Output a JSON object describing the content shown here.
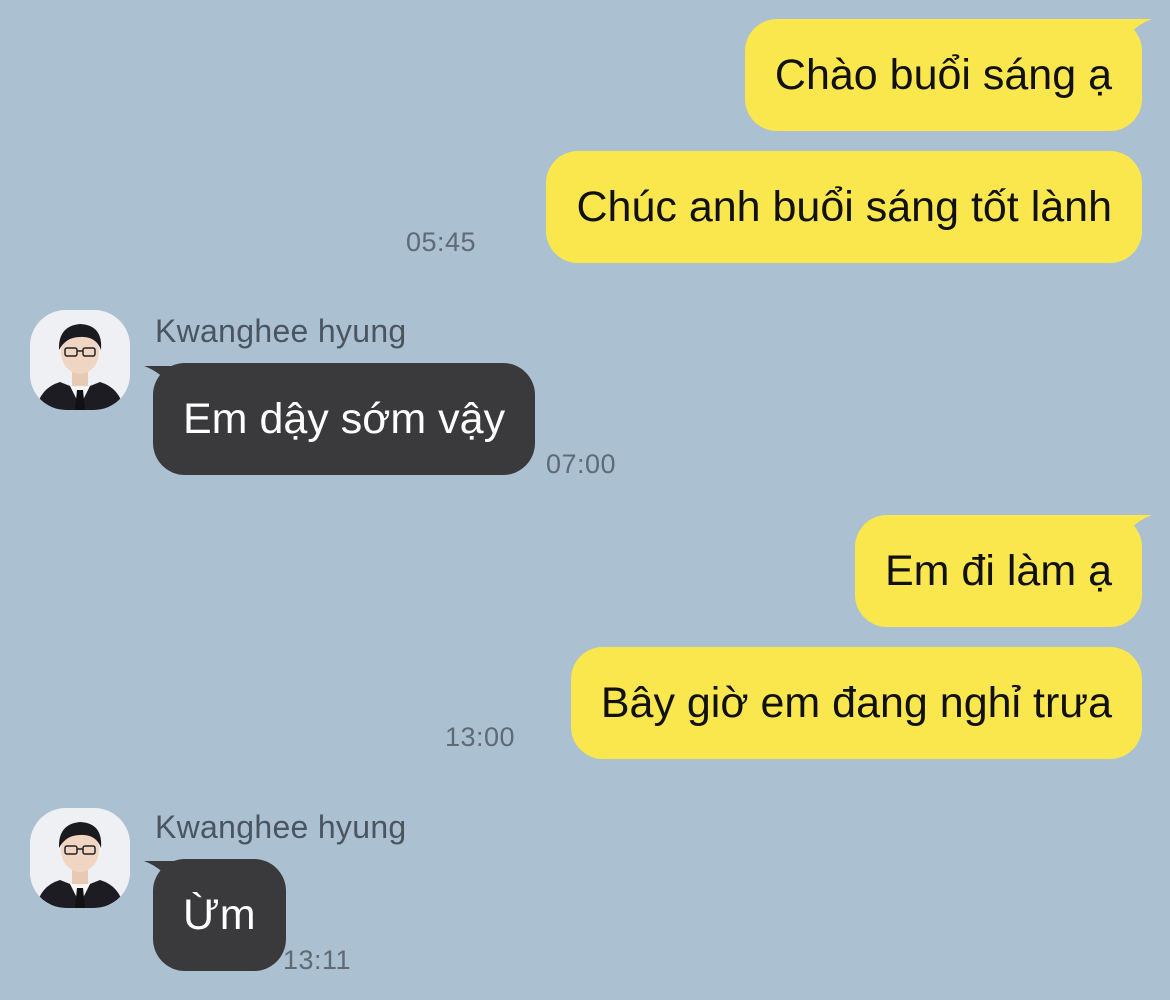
{
  "messages": [
    {
      "direction": "out",
      "text": "Chào buổi sáng ạ"
    },
    {
      "direction": "out",
      "text": "Chúc anh buổi sáng tốt lành",
      "time": "05:45"
    },
    {
      "direction": "in",
      "sender": "Kwanghee hyung",
      "text": "Em dậy sớm vậy",
      "time": "07:00",
      "avatar_icon": "user-avatar-icon"
    },
    {
      "direction": "out",
      "text": "Em đi làm ạ"
    },
    {
      "direction": "out",
      "text": "Bây giờ em đang nghỉ trưa",
      "time": "13:00"
    },
    {
      "direction": "in",
      "sender": "Kwanghee hyung",
      "text": "Ừm",
      "time": "13:11",
      "avatar_icon": "user-avatar-icon"
    }
  ],
  "colors": {
    "background": "#abc1d1",
    "outgoing_bubble": "#fae64d",
    "incoming_bubble": "#3a3a3c",
    "timestamp": "#5f6a75"
  }
}
